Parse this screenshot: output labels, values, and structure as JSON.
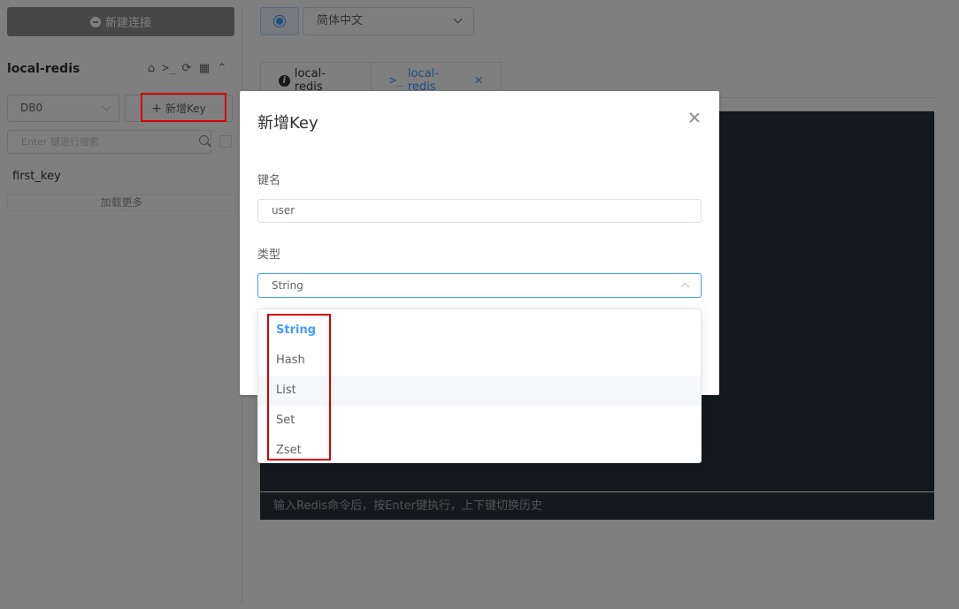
{
  "sidebar": {
    "new_connection_label": "新建连接",
    "connection_name": "local-redis",
    "db_select_value": "DB0",
    "new_key_label": "新增Key",
    "search_placeholder": "Enter 键进行搜索",
    "keys": [
      "first_key"
    ],
    "load_more_label": "加载更多",
    "connection_icons": [
      "home-icon",
      "terminal-icon",
      "refresh-icon",
      "grid-icon",
      "chevron-up-icon"
    ]
  },
  "topbar": {
    "language_value": "简体中文"
  },
  "tabs": [
    {
      "label": "local-redis",
      "icon": "info-icon"
    },
    {
      "label": "local-redis",
      "icon": "terminal-icon",
      "closable": true
    }
  ],
  "console": {
    "placeholder": "输入Redis命令后，按Enter键执行，上下键切换历史"
  },
  "dialog": {
    "title": "新增Key",
    "key_name_label": "键名",
    "key_name_value": "user",
    "type_label": "类型",
    "type_value": "String",
    "type_options": [
      "String",
      "Hash",
      "List",
      "Set",
      "Zset"
    ],
    "selected_option_index": 0,
    "hover_option_index": 2
  },
  "colors": {
    "accent": "#409eff",
    "highlight_box": "#d40000",
    "console_bg": "#263238",
    "overlay": "rgba(0,0,0,0.5)"
  }
}
